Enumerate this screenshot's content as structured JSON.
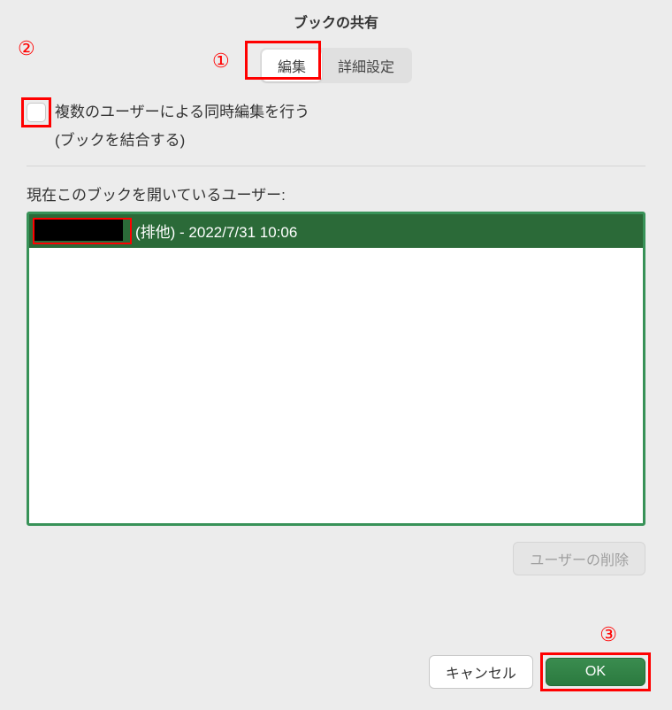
{
  "title": "ブックの共有",
  "tabs": {
    "edit": "編集",
    "advanced": "詳細設定"
  },
  "checkbox": {
    "label_line1": "複数のユーザーによる同時編集を行う",
    "label_line2": "(ブックを結合する)"
  },
  "users_section": {
    "label": "現在このブックを開いているユーザー:",
    "item_text": "(排他) - 2022/7/31 10:06"
  },
  "buttons": {
    "remove_user": "ユーザーの削除",
    "cancel": "キャンセル",
    "ok": "OK"
  },
  "annotations": {
    "n1": "①",
    "n2": "②",
    "n3": "③"
  }
}
